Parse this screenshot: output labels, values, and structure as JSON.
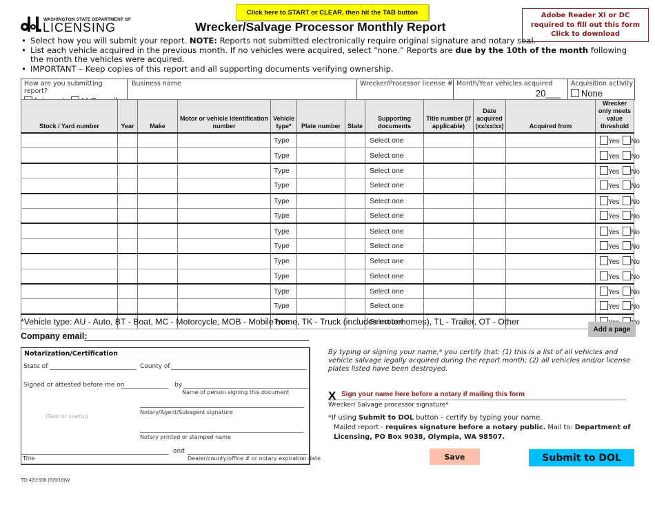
{
  "header": {
    "logo_small": "WASHINGTON STATE DEPARTMENT OF",
    "logo_big": "LICENSING",
    "start_button": "Click here to START or CLEAR, then hit the TAB button",
    "title": "Wrecker/Salvage Processor Monthly Report",
    "adobe_notice": [
      "Adobe Reader XI or DC",
      "required to fill out this form",
      "Click to download"
    ]
  },
  "instructions": {
    "item1_pre": "Select how you will submit your report. ",
    "item1_bold": "NOTE:",
    "item1_post": " Reports not submitted electronically require original signature and notary seal.",
    "item2_pre": "List each vehicle acquired in the previous month. If no vehicles were acquired, select “none.” Reports are ",
    "item2_bold": "due by the 10th of the month",
    "item2_post": " following the month the vehicles were acquired.",
    "item3": "IMPORTANT – Keep copies of this report and all supporting documents verifying ownership."
  },
  "info_row": {
    "submit_label": "How are you submitting report?",
    "option_internet": "Internet",
    "option_mail": "U.S. mail",
    "business_label": "Business name",
    "business_value": "",
    "license_label": "Wrecker/Processor license #",
    "license_value": "",
    "month_label": "Month/Year vehicles acquired",
    "month_value": "20___",
    "activity_label": "Acquisition activity",
    "activity_option": "None"
  },
  "table": {
    "headers": [
      "Stock / Yard number",
      "Year",
      "Make",
      "Motor or vehicle Identification number",
      "Vehicle type*",
      "Plate number",
      "State",
      "Supporting documents",
      "Title number (if applicable)",
      "Date acquired (xx/xx/xx)",
      "Acquired from",
      "Wrecker only meets value threshold"
    ],
    "type_placeholder": "Type",
    "docs_placeholder": "Select one",
    "yes_label": "Yes",
    "no_label": "No",
    "row_count": 13
  },
  "vehicle_type_note": "*Vehicle type: AU - Auto, BT - Boat, MC - Motorcycle,  MOB - Mobile home, TK - Truck (includes motorhomes), TL - Trailer, OT - Other",
  "add_page_button": "Add a page",
  "company_email_label": "Company email:",
  "company_email_value": "",
  "notary": {
    "title": "Notarization/Certification",
    "state_of": "State of",
    "county_of": "County of",
    "signed_before": "Signed or attested before me on",
    "by": "by",
    "name_person": "Name of person signing this document",
    "seal": "(Seal or stamp)",
    "notary_sig": "Notary/Agent/Subagent signature",
    "notary_name": "Notary printed or stamped name",
    "and": "and",
    "title_label": "Title",
    "dealer_label": "Dealer/county/office # or notary expiration date"
  },
  "certification": {
    "text": "By typing or signing your name,* you certify that: (1) this is a list of all vehicles and vehicle salvage legally acquired during the report month; (2) all vehicles and/or license plates listed have been destroyed.",
    "sign_x": "X",
    "sign_prompt": "Sign your name here before a notary if mailing this form",
    "sign_label": "Wrecker/ Salvage processor signature*",
    "if_using_pre": "*If using ",
    "if_using_bold": "Submit to DOL",
    "if_using_post": " button – certify by typing your name.",
    "mailed_pre": "Mailed report - ",
    "mailed_bold1": "requires signature before a notary public.",
    "mailed_mid": " Mail to: ",
    "mailed_bold2": "Department of Licensing, PO Box 9038, Olympia, WA  98507."
  },
  "buttons": {
    "save": "Save",
    "submit": "Submit to DOL"
  },
  "colors": {
    "start_button_bg": "#ffff00",
    "adobe_border": "#8b2323",
    "save_bg": "#ffbfaa",
    "submit_bg": "#00bfff",
    "sign_prompt": "#8b1a1a"
  },
  "form_id": "TD-420-538 (R/9/19)W"
}
